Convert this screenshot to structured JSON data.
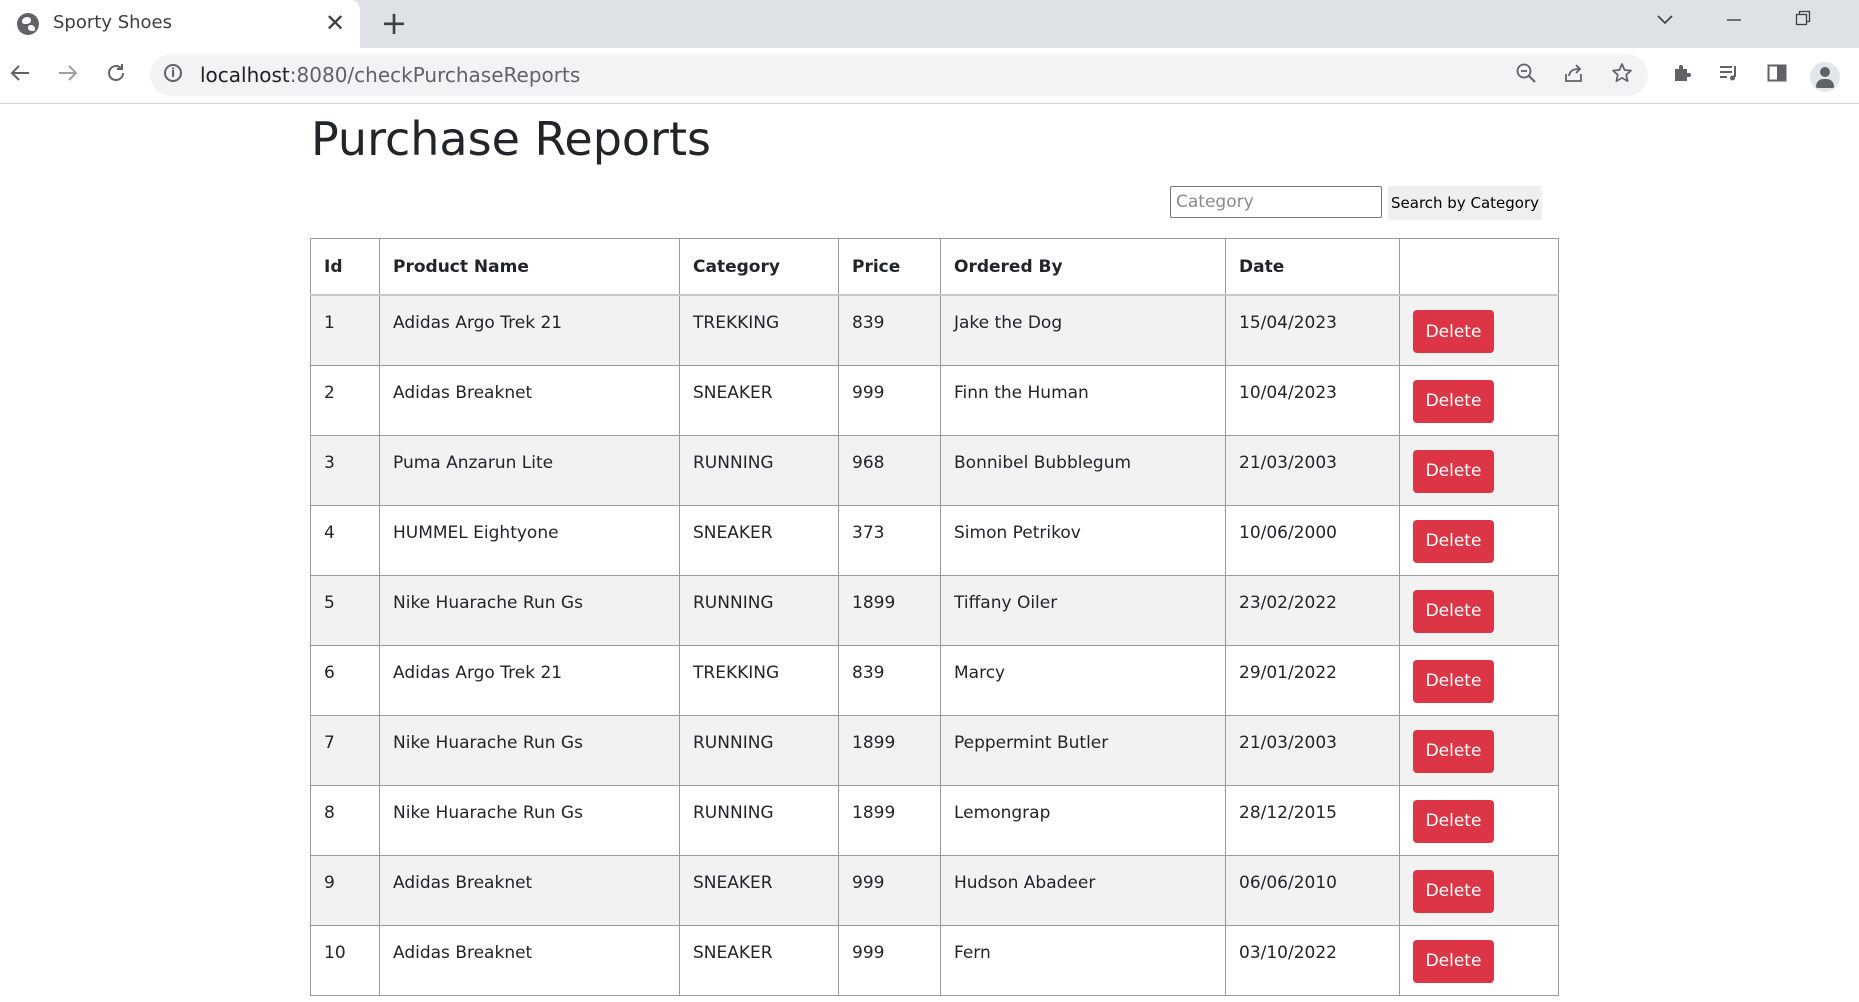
{
  "browser": {
    "tab_title": "Sporty Shoes",
    "tab_close": "✕",
    "new_tab": "+",
    "url_host": "localhost",
    "url_path": ":8080/checkPurchaseReports",
    "icons": [
      "globe-icon",
      "close-icon",
      "plus-icon",
      "chevron-down-icon",
      "minimize-icon",
      "restore-icon",
      "back-icon",
      "forward-icon",
      "reload-icon",
      "info-icon",
      "zoom-out-icon",
      "share-icon",
      "star-icon",
      "extensions-icon",
      "media-icon",
      "side-panel-icon",
      "profile-icon"
    ]
  },
  "page": {
    "title": "Purchase Reports"
  },
  "search": {
    "placeholder": "Category",
    "button_label": "Search by Category"
  },
  "table": {
    "headers": [
      "Id",
      "Product Name",
      "Category",
      "Price",
      "Ordered By",
      "Date",
      ""
    ],
    "delete_label": "Delete",
    "rows": [
      {
        "id": "1",
        "product": "Adidas Argo Trek 21",
        "category": "TREKKING",
        "price": "839",
        "ordered_by": "Jake the Dog",
        "date": "15/04/2023"
      },
      {
        "id": "2",
        "product": "Adidas Breaknet",
        "category": "SNEAKER",
        "price": "999",
        "ordered_by": "Finn the Human",
        "date": "10/04/2023"
      },
      {
        "id": "3",
        "product": "Puma Anzarun Lite",
        "category": "RUNNING",
        "price": "968",
        "ordered_by": "Bonnibel Bubblegum",
        "date": "21/03/2003"
      },
      {
        "id": "4",
        "product": "HUMMEL Eightyone",
        "category": "SNEAKER",
        "price": "373",
        "ordered_by": "Simon Petrikov",
        "date": "10/06/2000"
      },
      {
        "id": "5",
        "product": "Nike Huarache Run Gs",
        "category": "RUNNING",
        "price": "1899",
        "ordered_by": "Tiffany Oiler",
        "date": "23/02/2022"
      },
      {
        "id": "6",
        "product": "Adidas Argo Trek 21",
        "category": "TREKKING",
        "price": "839",
        "ordered_by": "Marcy",
        "date": "29/01/2022"
      },
      {
        "id": "7",
        "product": "Nike Huarache Run Gs",
        "category": "RUNNING",
        "price": "1899",
        "ordered_by": "Peppermint Butler",
        "date": "21/03/2003"
      },
      {
        "id": "8",
        "product": "Nike Huarache Run Gs",
        "category": "RUNNING",
        "price": "1899",
        "ordered_by": "Lemongrap",
        "date": "28/12/2015"
      },
      {
        "id": "9",
        "product": "Adidas Breaknet",
        "category": "SNEAKER",
        "price": "999",
        "ordered_by": "Hudson Abadeer",
        "date": "06/06/2010"
      },
      {
        "id": "10",
        "product": "Adidas Breaknet",
        "category": "SNEAKER",
        "price": "999",
        "ordered_by": "Fern",
        "date": "03/10/2022"
      }
    ]
  },
  "colors": {
    "delete_button": "#dc3545",
    "stripe": "#f2f2f2",
    "tabstrip": "#dee1e6"
  }
}
